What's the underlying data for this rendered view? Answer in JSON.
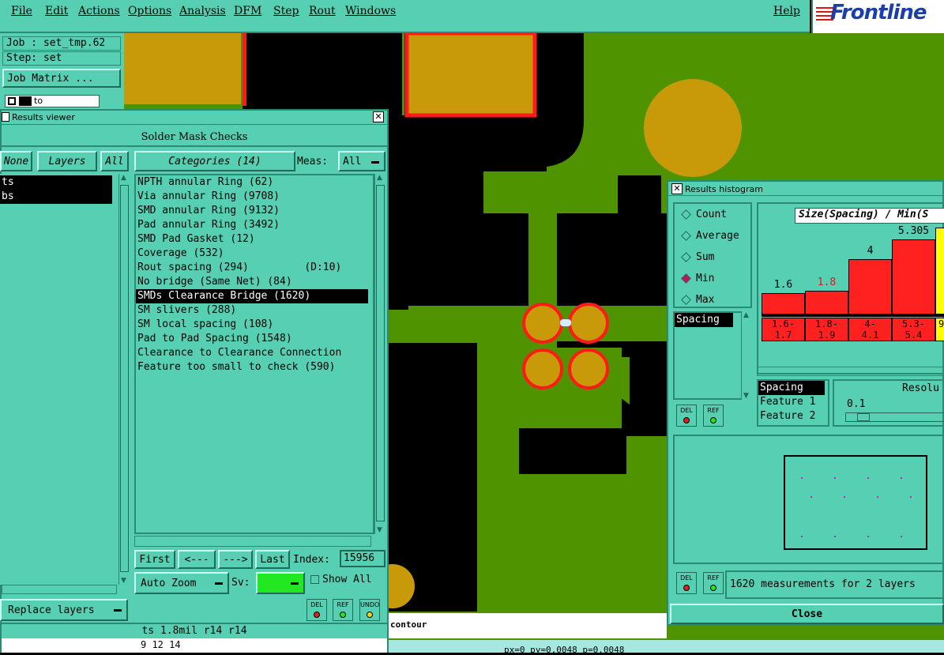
{
  "menu": {
    "items": [
      "File",
      "Edit",
      "Actions",
      "Options",
      "Analysis",
      "DFM",
      "Step",
      "Rout",
      "Windows"
    ],
    "help": "Help",
    "logo_text": "Frontline"
  },
  "job_panel": {
    "job": "Job : set_tmp.62",
    "step": "Step: set",
    "job_matrix": "Job Matrix ...",
    "layer_field": "to"
  },
  "results_viewer": {
    "title": "Results viewer",
    "heading": "Solder Mask Checks",
    "none_btn": "None",
    "layers_btn": "Layers",
    "all_btn": "All",
    "categories_btn": "Categories (14)",
    "meas_label": "Meas:",
    "meas_value": "All",
    "layers": [
      "ts",
      "bs"
    ],
    "categories": [
      "NPTH annular Ring (62)",
      "Via annular Ring (9708)",
      "SMD annular Ring (9132)",
      "Pad annular Ring (3492)",
      "SMD Pad Gasket (12)",
      "Coverage (532)",
      "Rout spacing (294)         (D:10)",
      "No bridge (Same Net) (84)",
      "SMDs Clearance Bridge (1620)",
      "SM slivers (288)",
      "SM local spacing (108)",
      "Pad to Pad Spacing (1548)",
      "Clearance to Clearance Connection",
      "Feature too small to check (590)"
    ],
    "selected_index": 8,
    "first_btn": "First",
    "prev_btn": "<---",
    "next_btn": "--->",
    "last_btn": "Last",
    "index_label": "Index:",
    "index_value": "15956",
    "auto_zoom": "Auto Zoom",
    "sv_label": "Sv:",
    "show_all": "Show All",
    "replace_layers": "Replace layers",
    "status": "ts 1.8mil  r14  r14",
    "bottom_values": "9 12 14",
    "del_label": "DEL",
    "ref_label": "REF",
    "undo_label": "UNDO"
  },
  "histogram": {
    "title": "Results histogram",
    "modes": [
      "Count",
      "Average",
      "Sum",
      "Min",
      "Max"
    ],
    "selected_mode": "Min",
    "chart_title": "Size(Spacing) / Min(S",
    "list_item": "Spacing",
    "bars": [
      {
        "value": "1.6",
        "range_a": "1.6-",
        "range_b": "1.7",
        "level": 0.27
      },
      {
        "value": "1.8",
        "range_a": "1.8-",
        "range_b": "1.9",
        "level": 0.3
      },
      {
        "value": "4",
        "range_a": "4-",
        "range_b": "4.1",
        "level": 0.7
      },
      {
        "value": "5.305",
        "range_a": "5.3-",
        "range_b": "5.4",
        "level": 0.95
      }
    ],
    "partial_bin": "9",
    "sort_options": [
      "Spacing",
      "Feature 1",
      "Feature 2"
    ],
    "resolution_label": "Resolu",
    "resolution_value": "0.1",
    "summary": "1620 measurements for 2 layers",
    "close": "Close",
    "del_label": "DEL",
    "ref_label": "REF"
  },
  "status_line": {
    "text": "contour",
    "coords": "px=0 py=0.0048 p=0.0048"
  },
  "colors": {
    "panel": "#56cfb3",
    "board": "#4f9400",
    "copper": "#c89a0a",
    "highlight": "#ff1a1a",
    "bar": "#ff2020",
    "bar_partial": "#ffff00"
  }
}
